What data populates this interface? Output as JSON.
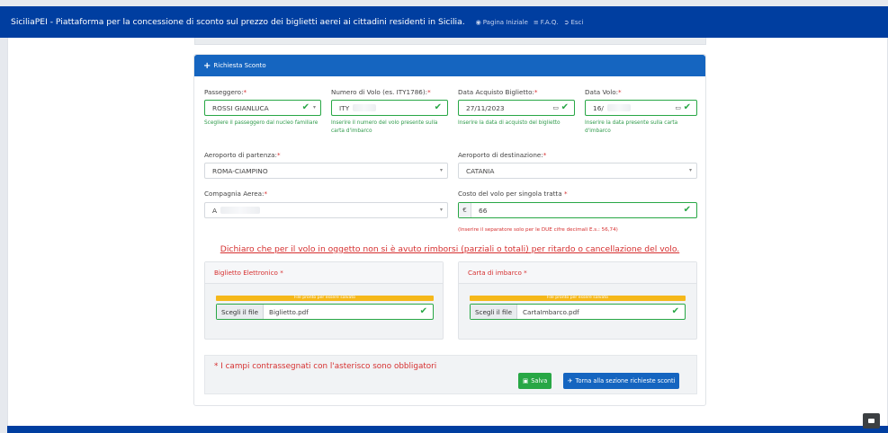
{
  "header": {
    "title": "SiciliaPEI - Piattaforma per la concessione di sconto sul prezzo dei biglietti aerei ai cittadini residenti in Sicilia.",
    "links": [
      {
        "icon": "home-icon",
        "label": "Pagina Iniziale"
      },
      {
        "icon": "list-icon",
        "label": "F.A.Q."
      },
      {
        "icon": "sign-out-icon",
        "label": "Esci"
      }
    ]
  },
  "card": {
    "title": "Richiesta Sconto"
  },
  "form": {
    "passenger": {
      "label": "Passeggero:",
      "value": "ROSSI GIANLUCA",
      "help": "Scegliere il passeggero dal nucleo familiare"
    },
    "flight_number": {
      "label": "Numero di Volo (es. ITY1786):",
      "value": "ITY",
      "help": "Inserire il numero del volo presente sulla carta d'imbarco"
    },
    "purchase_date": {
      "label": "Data Acquisto Biglietto:",
      "value": "27/11/2023",
      "help": "Inserire la data di acquisto del biglietto"
    },
    "flight_date": {
      "label": "Data Volo:",
      "value": "16/",
      "help": "Inserire la data presente sulla carta d'imbarco"
    },
    "departure": {
      "label": "Aeroporto di partenza:",
      "value": "ROMA-CIAMPINO"
    },
    "destination": {
      "label": "Aeroporto di destinazione:",
      "value": "CATANIA"
    },
    "airline": {
      "label": "Compagnia Aerea:",
      "value": "A"
    },
    "cost": {
      "label": "Costo del volo per singola tratta",
      "currency": "€",
      "value": "66",
      "help": "(Inserire il separatore solo per le DUE cifre decimali E.s.: 56,74)"
    }
  },
  "declaration": "Dichiaro che per il volo in oggetto non si è avuto rimborsi (parziali o totali) per ritardo o cancellazione del volo.",
  "uploads": {
    "ticket": {
      "title": "Biglietto Elettronico",
      "status": "File pronto per essere salvato",
      "choose": "Scegli il file",
      "file": "Biglietto.pdf"
    },
    "boarding": {
      "title": "Carta di imbarco",
      "status": "File pronto per essere salvato",
      "choose": "Scegli il file",
      "file": "CartaImbarco.pdf"
    }
  },
  "footer": {
    "mandatory": "* I campi contrassegnati con l'asterisco sono obbligatori",
    "save": "Salva",
    "back": "Torna alla sezione richieste sconti"
  },
  "colors": {
    "primary": "#1565c0",
    "navbar": "#003ea0",
    "success": "#28a745",
    "danger": "#d63030",
    "warning": "#f5b81a"
  }
}
